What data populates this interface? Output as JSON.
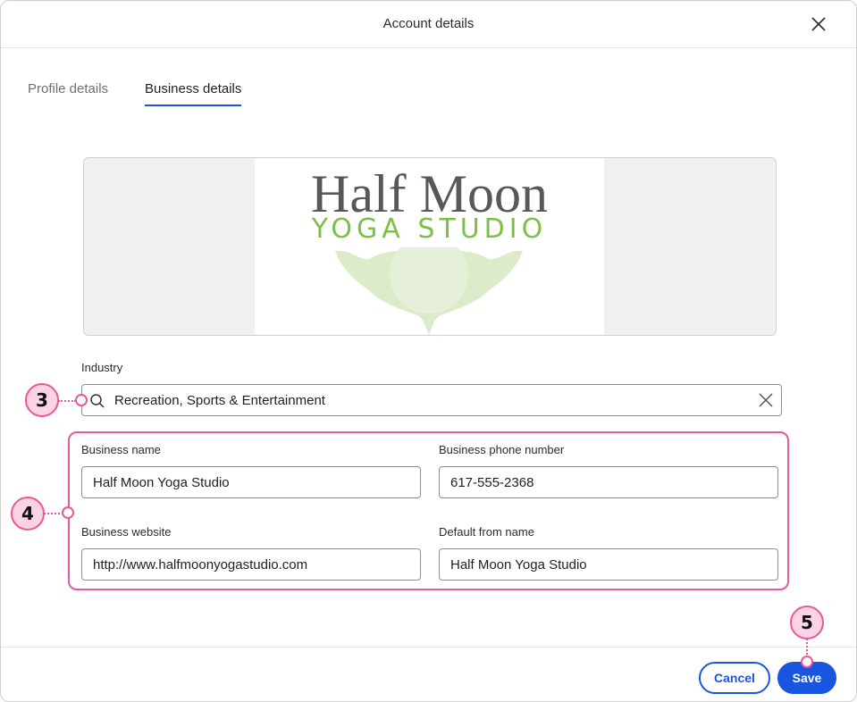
{
  "dialog": {
    "title": "Account details"
  },
  "tabs": [
    {
      "label": "Profile details",
      "active": false
    },
    {
      "label": "Business details",
      "active": true
    }
  ],
  "logo": {
    "line1": "Half Moon",
    "line2": "YOGA STUDIO",
    "colors": {
      "text": "#555a58",
      "accent": "#7cc04a",
      "lotus": "#d9ebc6"
    }
  },
  "industry": {
    "label": "Industry",
    "value": "Recreation, Sports & Entertainment",
    "search_icon": "search-icon",
    "clear_icon": "close-icon"
  },
  "fields": {
    "business_name": {
      "label": "Business name",
      "value": "Half Moon Yoga Studio"
    },
    "business_phone": {
      "label": "Business phone number",
      "value": "617-555-2368"
    },
    "business_website": {
      "label": "Business website",
      "value": "http://www.halfmoonyogastudio.com"
    },
    "default_from_name": {
      "label": "Default from name",
      "value": "Half Moon Yoga Studio"
    }
  },
  "callouts": {
    "industry": "3",
    "fields_group": "4",
    "save": "5",
    "color": "#e9579d"
  },
  "footer": {
    "cancel_label": "Cancel",
    "save_label": "Save"
  },
  "colors": {
    "primary": "#1856e0",
    "border": "#8d8d8d"
  }
}
